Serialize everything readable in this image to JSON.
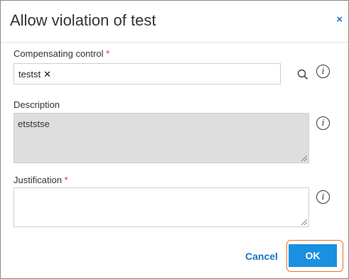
{
  "dialog": {
    "title": "Allow violation of test",
    "close_glyph": "×"
  },
  "compensating_control": {
    "label": "Compensating control",
    "required_mark": "*",
    "chip_value": "testst",
    "chip_remove_glyph": "✕",
    "search_icon": "search-icon",
    "info_glyph": "i"
  },
  "description": {
    "label": "Description",
    "value": "etststse",
    "info_glyph": "i"
  },
  "justification": {
    "label": "Justification",
    "required_mark": "*",
    "value": "",
    "info_glyph": "i"
  },
  "footer": {
    "cancel_label": "Cancel",
    "ok_label": "OK"
  },
  "colors": {
    "accent": "#1a90e0",
    "link": "#1a73c9",
    "required": "#d9312b",
    "focus_outline": "#e8742f",
    "readonly_bg": "#dedede"
  }
}
